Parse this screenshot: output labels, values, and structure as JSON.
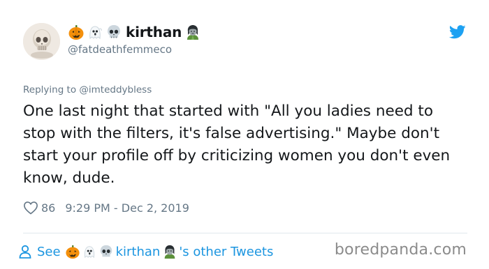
{
  "tweet": {
    "display_name": "kirthan",
    "name_emojis": [
      "pumpkin-icon",
      "ghost-icon",
      "skull-icon"
    ],
    "name_suffix_emoji": "zombie-woman-icon",
    "handle": "@fatdeathfemmeco",
    "replying_prefix": "Replying to",
    "replying_to": "@imteddybless",
    "text": "One last night that started with \"All you ladies need to stop with the filters, it's false advertising.\" Maybe don't start your profile off by criticizing women you don't even know, dude.",
    "likes": "86",
    "timestamp": "9:29 PM - Dec 2, 2019"
  },
  "footer": {
    "see_label": "See",
    "other_tweets_label": "'s other Tweets"
  },
  "watermark": "boredpanda.com",
  "colors": {
    "twitter_blue": "#1da1f2",
    "link_blue": "#1b95e0",
    "muted": "#657786",
    "pumpkin": "#f4900c"
  }
}
